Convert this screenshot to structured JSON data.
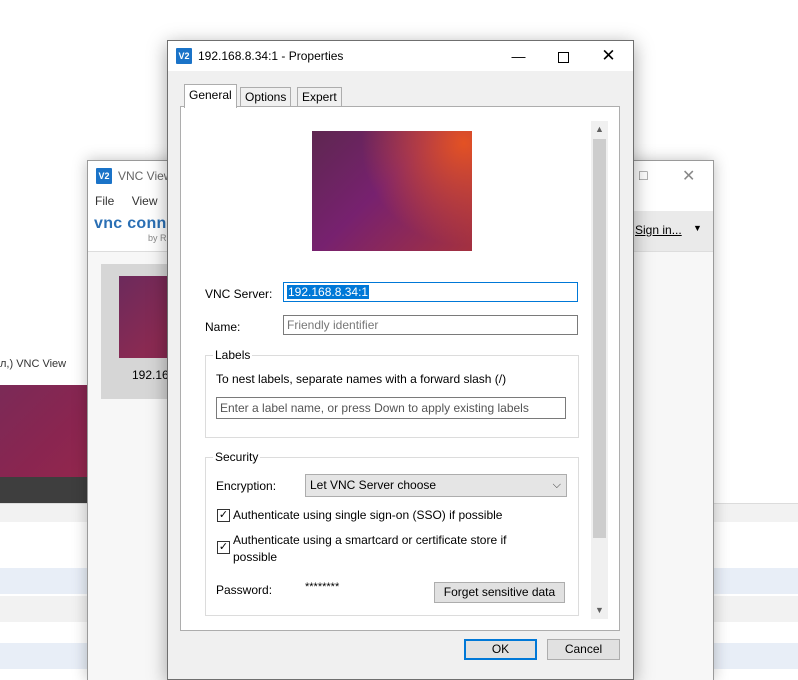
{
  "background": {
    "snippet_text": "л,)   VNC View"
  },
  "main_window": {
    "title": "VNC View",
    "logo_text": "V2",
    "menu": [
      "File",
      "View"
    ],
    "brand": "vnc conn",
    "brand_by": "by R",
    "sign_in_label": "Sign in...",
    "minimize_glyph": "☐",
    "close_glyph": "✕",
    "tile_label": "192.16"
  },
  "dialog": {
    "title": "192.168.8.34:1 - Properties",
    "logo_text": "V2",
    "minimize_glyph": "—",
    "close_glyph": "✕",
    "tabs": [
      {
        "label": "General",
        "active": true
      },
      {
        "label": "Options",
        "active": false
      },
      {
        "label": "Expert",
        "active": false
      }
    ],
    "general": {
      "vnc_server_label": "VNC Server:",
      "vnc_server_value": "192.168.8.34:1",
      "name_label": "Name:",
      "name_placeholder": "Friendly identifier",
      "labels_group_title": "Labels",
      "labels_hint": "To nest labels, separate names with a forward slash (/)",
      "labels_placeholder": "Enter a label name, or press Down to apply existing labels",
      "security_group_title": "Security",
      "encryption_label": "Encryption:",
      "encryption_value": "Let VNC Server choose",
      "sso_label": "Authenticate using single sign-on (SSO) if possible",
      "sso_checked": true,
      "smartcard_label_line1": "Authenticate using a smartcard or certificate store if",
      "smartcard_label_line2": "possible",
      "smartcard_checked": true,
      "password_label": "Password:",
      "password_value": "********",
      "forget_button": "Forget sensitive data"
    },
    "ok_button": "OK",
    "cancel_button": "Cancel"
  },
  "colors": {
    "accent": "#0078d7",
    "row_blue": "#e8eef7"
  }
}
